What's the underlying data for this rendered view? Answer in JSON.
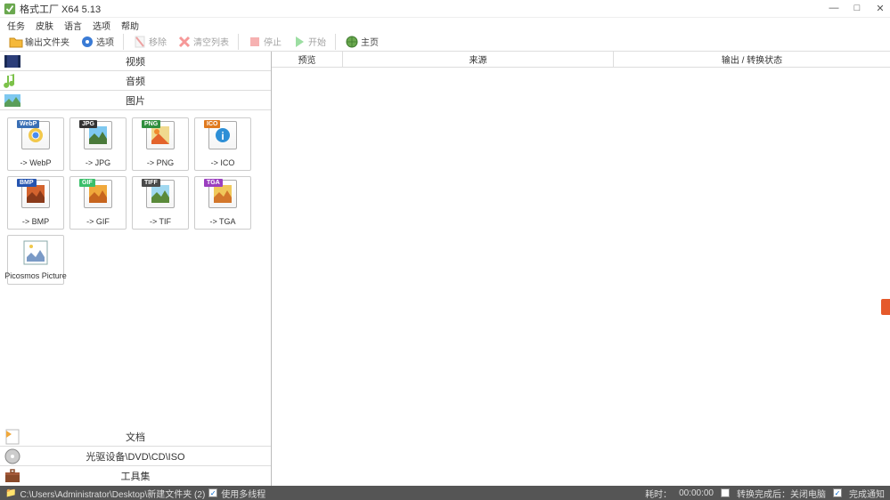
{
  "window": {
    "title": "格式工厂 X64 5.13",
    "controls": {
      "min": "—",
      "max": "□",
      "close": "✕"
    }
  },
  "menu": [
    "任务",
    "皮肤",
    "语言",
    "选项",
    "帮助"
  ],
  "toolbar": {
    "output_folder": "输出文件夹",
    "options": "选项",
    "remove": "移除",
    "clear": "清空列表",
    "stop": "停止",
    "start": "开始",
    "homepage": "主页"
  },
  "left": {
    "cat_video": "视频",
    "cat_audio": "音频",
    "cat_image": "图片",
    "cat_document": "文档",
    "cat_disc": "光驱设备\\DVD\\CD\\ISO",
    "cat_tools": "工具集",
    "formats": [
      {
        "badge": "WebP",
        "badge_color": "#3a6fb5",
        "label": "-> WebP"
      },
      {
        "badge": "JPG",
        "badge_color": "#333333",
        "label": "-> JPG"
      },
      {
        "badge": "PNG",
        "badge_color": "#2f8f3e",
        "label": "-> PNG"
      },
      {
        "badge": "ICO",
        "badge_color": "#e07a1f",
        "label": "-> ICO"
      },
      {
        "badge": "BMP",
        "badge_color": "#2655b0",
        "label": "-> BMP"
      },
      {
        "badge": "GIF",
        "badge_color": "#3bbf6a",
        "label": "-> GIF"
      },
      {
        "badge": "TIFF",
        "badge_color": "#4a4a4a",
        "label": "-> TIF"
      },
      {
        "badge": "TGA",
        "badge_color": "#9b3fbf",
        "label": "-> TGA"
      },
      {
        "badge": "",
        "badge_color": "",
        "label": "Picosmos Picture"
      }
    ]
  },
  "columns": {
    "preview": "预览",
    "source": "来源",
    "output": "输出 / 转换状态"
  },
  "status": {
    "folder_icon": "📁",
    "path": "C:\\Users\\Administrator\\Desktop\\新建文件夹 (2)",
    "multithread": "使用多线程",
    "elapsed_label": "耗时：",
    "elapsed": "00:00:00",
    "shutdown": "转换完成后：关闭电脑",
    "notify": "完成通知"
  }
}
